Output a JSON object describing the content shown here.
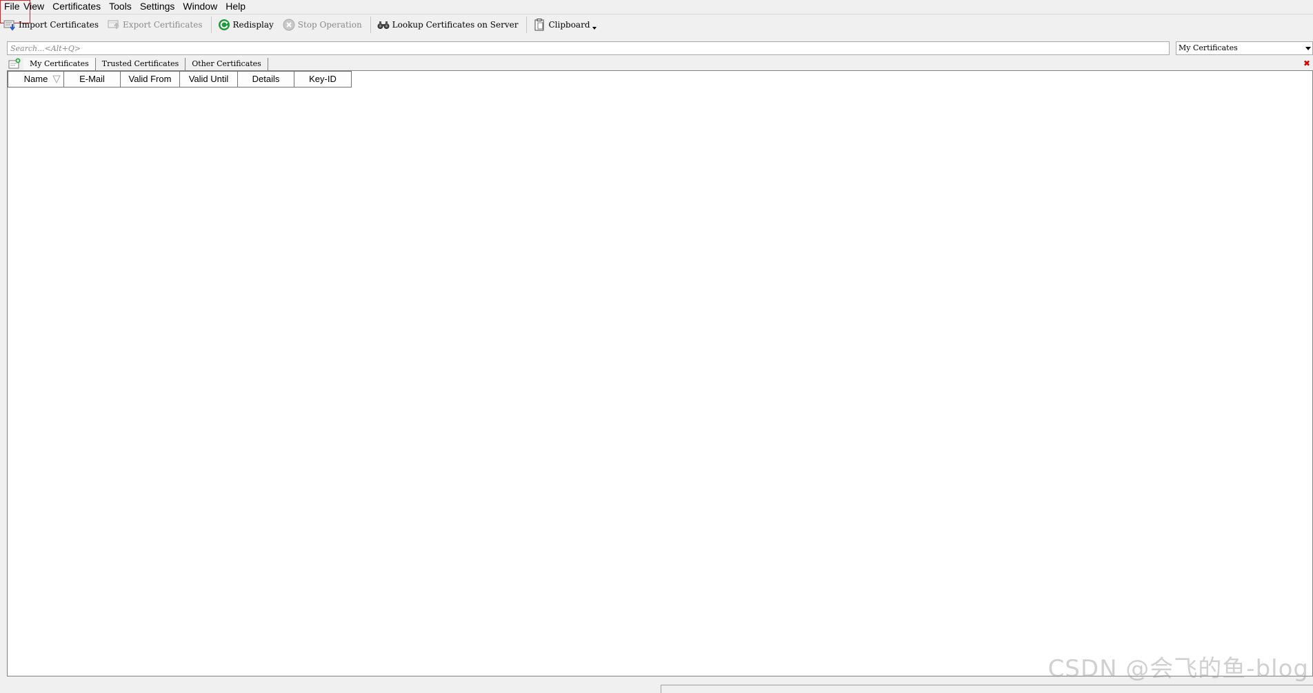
{
  "menu": {
    "file": "File",
    "view": "View",
    "certificates": "Certificates",
    "tools": "Tools",
    "settings": "Settings",
    "window": "Window",
    "help": "Help"
  },
  "toolbar": {
    "import": "Import Certificates",
    "export": "Export Certificates",
    "redisplay": "Redisplay",
    "stop": "Stop Operation",
    "lookup": "Lookup Certificates on Server",
    "clipboard": "Clipboard"
  },
  "search": {
    "placeholder": "Search...<Alt+Q>",
    "scope": "My Certificates"
  },
  "tabs": [
    "My Certificates",
    "Trusted Certificates",
    "Other Certificates"
  ],
  "table": {
    "columns": [
      "Name",
      "E-Mail",
      "Valid From",
      "Valid Until",
      "Details",
      "Key-ID"
    ]
  },
  "watermark": "CSDN @会飞的鱼-blog",
  "colors": {
    "focus_outline": "#e02020",
    "close_tab": "#d40000",
    "redisplay_green": "#1f9a3a"
  }
}
